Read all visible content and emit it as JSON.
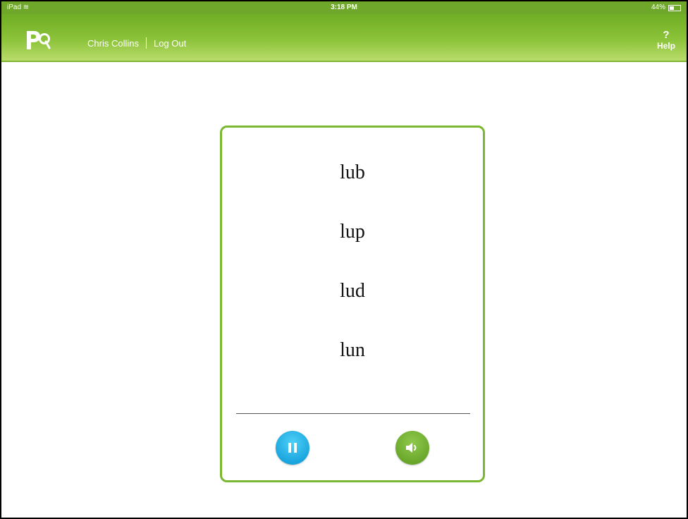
{
  "status_bar": {
    "device": "iPad",
    "time": "3:18 PM",
    "battery": "44%"
  },
  "header": {
    "user_name": "Chris Collins",
    "logout_label": "Log Out",
    "help_symbol": "?",
    "help_label": "Help",
    "logo_icon": "pq-logo-icon"
  },
  "card": {
    "words": [
      "lub",
      "lup",
      "lud",
      "lun"
    ]
  },
  "controls": {
    "pause_icon": "pause-icon",
    "sound_icon": "speaker-icon"
  },
  "colors": {
    "brand_green": "#7ab832",
    "pause_blue": "#1ba6df",
    "sound_green": "#6aa82d"
  }
}
